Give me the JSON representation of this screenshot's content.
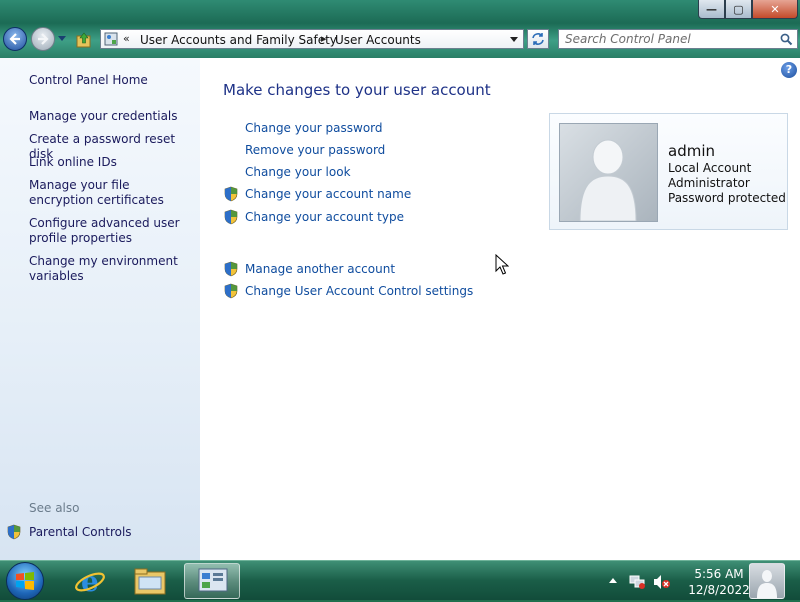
{
  "window": {
    "controls": {
      "minimize": "—",
      "maximize": "▢",
      "close": "✕"
    }
  },
  "navbar": {
    "back_icon": "back-arrow-icon",
    "forward_icon": "forward-arrow-icon",
    "breadcrumb": [
      "User Accounts and Family Safety",
      "User Accounts"
    ],
    "overflow_chevron": "«",
    "separator": "▸",
    "search": {
      "placeholder": "Search Control Panel",
      "value": ""
    }
  },
  "sidebar": {
    "home": "Control Panel Home",
    "links": [
      "Manage your credentials",
      "Create a password reset disk",
      "Link online IDs",
      "Manage your file encryption certificates",
      "Configure advanced user profile properties",
      "Change my environment variables"
    ],
    "see_also_label": "See also",
    "see_also_links": [
      "Parental Controls"
    ]
  },
  "main": {
    "help": "?",
    "heading": "Make changes to your user account",
    "links": [
      {
        "label": "Change your password",
        "shield": false
      },
      {
        "label": "Remove your password",
        "shield": false
      },
      {
        "label": "Change your look",
        "shield": false
      },
      {
        "label": "Change your account name",
        "shield": true
      },
      {
        "label": "Change your account type",
        "shield": true
      }
    ],
    "other_links": [
      {
        "label": "Manage another account",
        "shield": true
      },
      {
        "label": "Change User Account Control settings",
        "shield": true
      }
    ],
    "account": {
      "name": "admin",
      "type": "Local Account",
      "role": "Administrator",
      "status": "Password protected"
    }
  },
  "taskbar": {
    "apps": [
      "internet-explorer-icon",
      "windows-explorer-icon",
      "control-panel-icon"
    ],
    "clock": {
      "time": "5:56 AM",
      "date": "12/8/2022"
    }
  },
  "colors": {
    "link": "#0f4c9e",
    "heading": "#1e3287",
    "sidebar_link": "#1a1a5c",
    "taskbar": "#1a5e48"
  }
}
